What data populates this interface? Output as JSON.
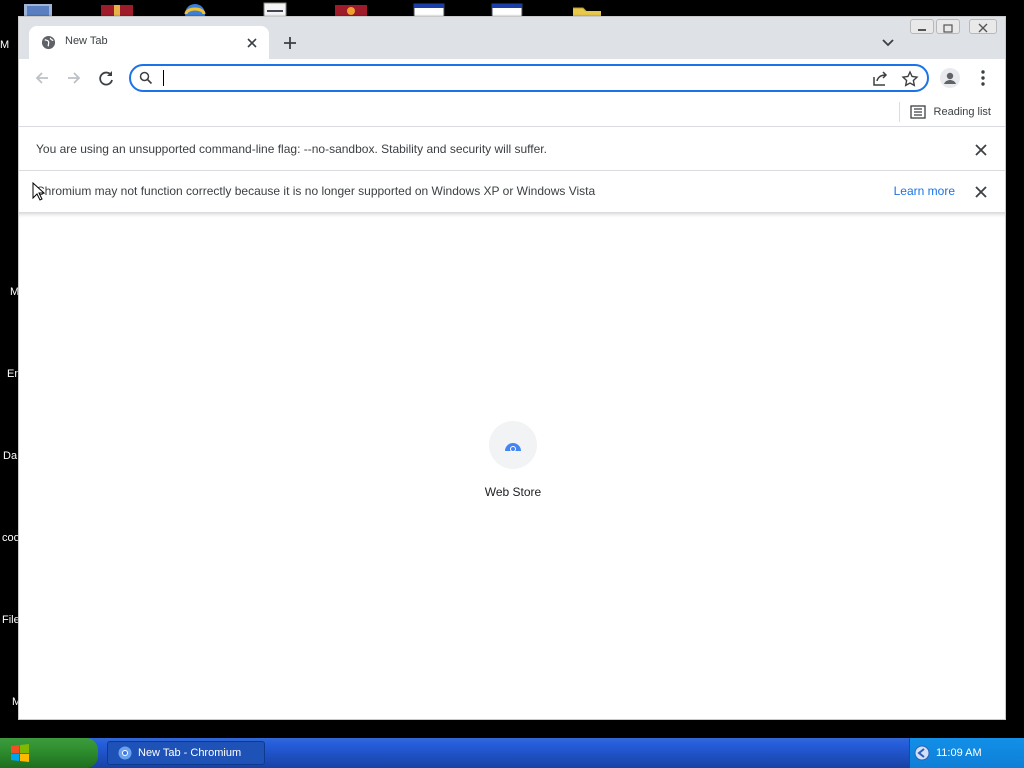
{
  "desktop": {
    "icon_labels": [
      "M",
      "M",
      "En",
      "Da",
      "coo",
      "File",
      "M"
    ]
  },
  "window": {
    "tab": {
      "title": "New Tab"
    },
    "omnibox": {
      "value": "",
      "placeholder": ""
    },
    "bookmark_bar": {
      "reading_list_label": "Reading list"
    },
    "infobars": [
      {
        "message": "You are using an unsupported command-line flag: --no-sandbox. Stability and security will suffer."
      },
      {
        "message": "Chromium may not function correctly because it is no longer supported on Windows XP or Windows Vista",
        "link": "Learn more"
      }
    ],
    "shortcut": {
      "label": "Web Store"
    }
  },
  "taskbar": {
    "task_label": "New Tab - Chromium",
    "clock": "11:09 AM"
  },
  "colors": {
    "accent": "#1a73e8",
    "tabstrip": "#dee1e6",
    "taskbar": "#245edb",
    "start_button": "#2f8f2f"
  }
}
